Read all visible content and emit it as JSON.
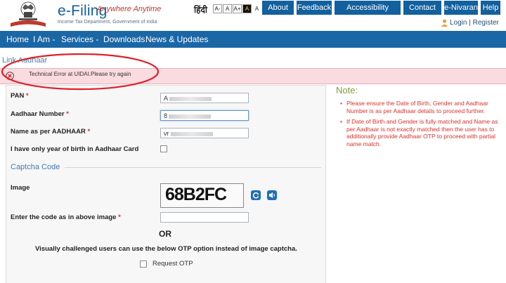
{
  "header": {
    "title": "e-Filing",
    "tagline": "Anywhere Anytime",
    "subtitle": "Income Tax Department, Government of India",
    "language": "हिंदी",
    "font_sizes": [
      "A-",
      "A",
      "A+",
      "A",
      "A"
    ],
    "top_buttons": [
      "About Us",
      "Feedback",
      "Accessibility Options",
      "Contact Us",
      "e-Nivaran",
      "Help"
    ],
    "login_text": "Login | Register"
  },
  "nav": {
    "items": [
      "Home",
      "I Am -",
      "Services -",
      "Downloads",
      "News & Updates"
    ]
  },
  "page": {
    "section_title": "Link Aadhaar",
    "error_message": "Technical Error at UIDAI.Please try again"
  },
  "form": {
    "pan": {
      "label": "PAN",
      "value": "A"
    },
    "aadhaar": {
      "label": "Aadhaar Number",
      "value": "8"
    },
    "name": {
      "label": "Name as per AADHAAR",
      "value": "vr"
    },
    "year_only": {
      "label": "I have only year of birth in Aadhaar Card"
    },
    "captcha_title": "Captcha Code",
    "image_label": "Image",
    "captcha_value": "68B2FC",
    "code_label": "Enter the code as in above image",
    "or": "OR",
    "visually_challenged": "Visually challenged users can use the below OTP option instead of image captcha.",
    "request_otp": "Request OTP"
  },
  "note": {
    "title": "Note:",
    "items": [
      "Please ensure the Date of Birth, Gender and Aadhaar Number is as per Aadhaar details to proceed further.",
      "If Date of Birth and Gender is fully matched and Name as per Aadhaar is not exactly matched then the user has to additionally provide Aadhaar OTP to proceed with partial name match."
    ]
  },
  "colors": {
    "primary_blue": "#13609b",
    "nav_blue": "#1b67a6",
    "error_bg": "#f9dbe0",
    "note_red": "#d9322c",
    "annotation_red": "#e0202a"
  }
}
